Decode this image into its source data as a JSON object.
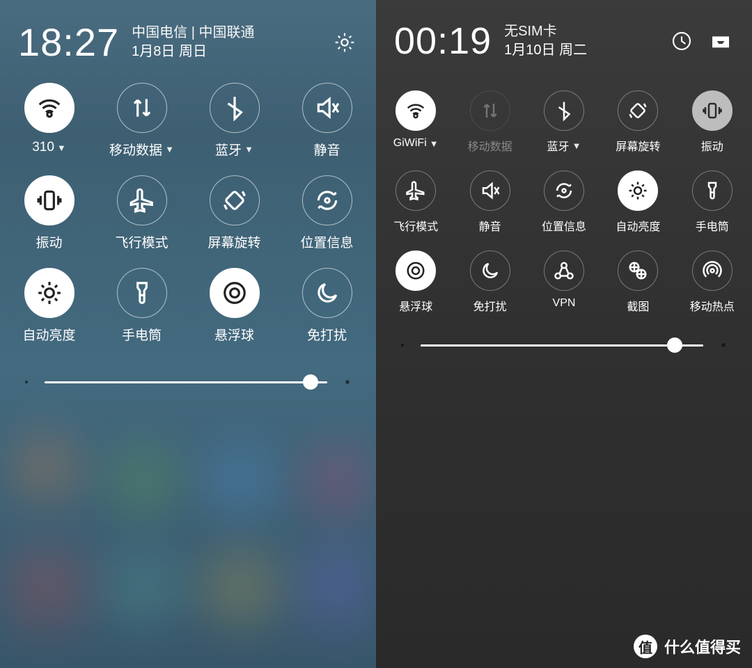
{
  "left": {
    "time": "18:27",
    "carrier": "中国电信 | 中国联通",
    "date": "1月8日 周日",
    "brightness_pct": 94,
    "toggles": [
      {
        "label": "310",
        "icon": "wifi",
        "on": true,
        "caret": true
      },
      {
        "label": "移动数据",
        "icon": "data",
        "on": false,
        "caret": true
      },
      {
        "label": "蓝牙",
        "icon": "bluetooth",
        "on": false,
        "caret": true
      },
      {
        "label": "静音",
        "icon": "mute",
        "on": false,
        "caret": false
      },
      {
        "label": "振动",
        "icon": "vibrate",
        "on": true,
        "caret": false
      },
      {
        "label": "飞行模式",
        "icon": "airplane",
        "on": false,
        "caret": false
      },
      {
        "label": "屏幕旋转",
        "icon": "rotate",
        "on": false,
        "caret": false
      },
      {
        "label": "位置信息",
        "icon": "location",
        "on": false,
        "caret": false
      },
      {
        "label": "自动亮度",
        "icon": "autobright",
        "on": true,
        "caret": false
      },
      {
        "label": "手电筒",
        "icon": "flashlight",
        "on": false,
        "caret": false
      },
      {
        "label": "悬浮球",
        "icon": "floatball",
        "on": true,
        "caret": false
      },
      {
        "label": "免打扰",
        "icon": "dnd",
        "on": false,
        "caret": false
      }
    ]
  },
  "right": {
    "time": "00:19",
    "carrier": "无SIM卡",
    "date": "1月10日 周二",
    "brightness_pct": 90,
    "toggles": [
      {
        "label": "GiWiFi",
        "icon": "wifi",
        "on": true,
        "caret": true
      },
      {
        "label": "移动数据",
        "icon": "data",
        "on": false,
        "caret": false,
        "dim": true
      },
      {
        "label": "蓝牙",
        "icon": "bluetooth",
        "on": false,
        "caret": true
      },
      {
        "label": "屏幕旋转",
        "icon": "rotate",
        "on": false,
        "caret": false
      },
      {
        "label": "振动",
        "icon": "vibrate",
        "on": true,
        "caret": false,
        "grey": true
      },
      {
        "label": "飞行模式",
        "icon": "airplane",
        "on": false,
        "caret": false
      },
      {
        "label": "静音",
        "icon": "mute",
        "on": false,
        "caret": false
      },
      {
        "label": "位置信息",
        "icon": "location",
        "on": false,
        "caret": false
      },
      {
        "label": "自动亮度",
        "icon": "autobright",
        "on": true,
        "caret": false
      },
      {
        "label": "手电筒",
        "icon": "flashlight",
        "on": false,
        "caret": false
      },
      {
        "label": "悬浮球",
        "icon": "floatball",
        "on": true,
        "caret": false
      },
      {
        "label": "免打扰",
        "icon": "dnd",
        "on": false,
        "caret": false
      },
      {
        "label": "VPN",
        "icon": "vpn",
        "on": false,
        "caret": false
      },
      {
        "label": "截图",
        "icon": "screenshot",
        "on": false,
        "caret": false
      },
      {
        "label": "移动热点",
        "icon": "hotspot",
        "on": false,
        "caret": false
      }
    ]
  },
  "watermark": {
    "badge": "值",
    "text": "什么值得买"
  }
}
